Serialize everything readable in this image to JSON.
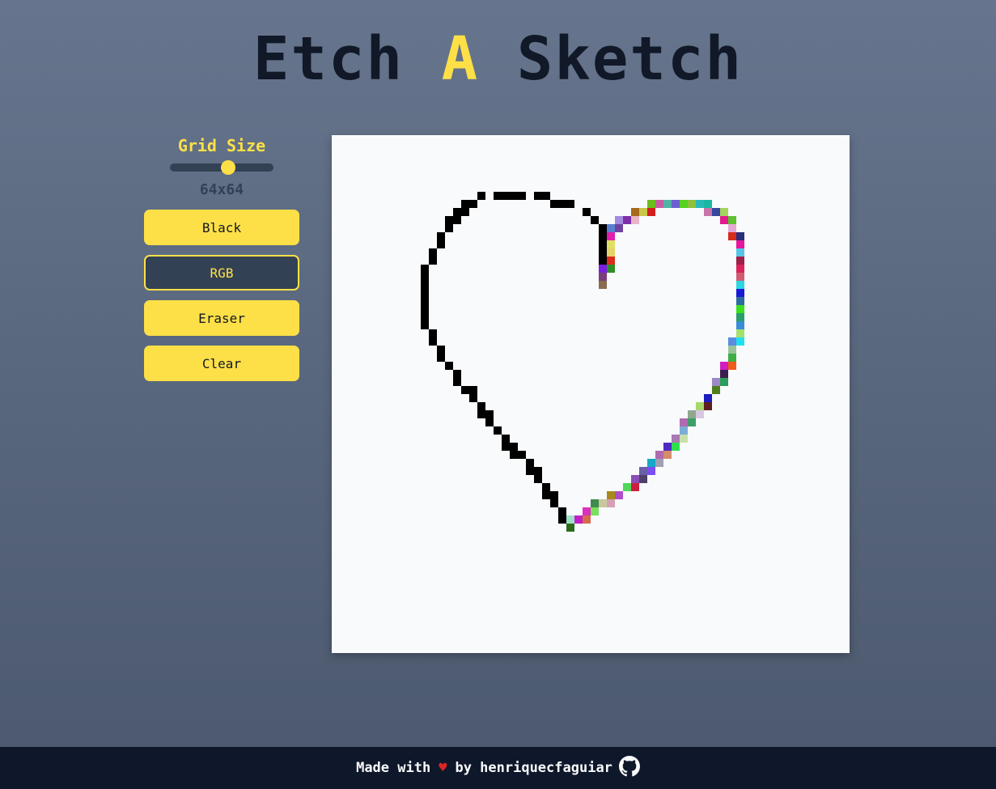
{
  "title": {
    "part1": "Etch ",
    "accent": "A",
    "part2": " Sketch"
  },
  "controls": {
    "grid_label": "Grid Size",
    "grid_value": "64x64",
    "slider_fraction": 0.56,
    "buttons": [
      {
        "label": "Black",
        "active": false
      },
      {
        "label": "RGB",
        "active": true
      },
      {
        "label": "Eraser",
        "active": false
      },
      {
        "label": "Clear",
        "active": false
      }
    ]
  },
  "grid": {
    "size": 64,
    "black_cells": [
      [
        18,
        7
      ],
      [
        20,
        7
      ],
      [
        21,
        7
      ],
      [
        22,
        7
      ],
      [
        23,
        7
      ],
      [
        25,
        7
      ],
      [
        26,
        7
      ],
      [
        16,
        8
      ],
      [
        17,
        8
      ],
      [
        27,
        8
      ],
      [
        28,
        8
      ],
      [
        29,
        8
      ],
      [
        15,
        9
      ],
      [
        16,
        9
      ],
      [
        31,
        9
      ],
      [
        14,
        10
      ],
      [
        15,
        10
      ],
      [
        32,
        10
      ],
      [
        14,
        11
      ],
      [
        33,
        11
      ],
      [
        13,
        12
      ],
      [
        33,
        12
      ],
      [
        13,
        13
      ],
      [
        33,
        13
      ],
      [
        12,
        14
      ],
      [
        33,
        14
      ],
      [
        12,
        15
      ],
      [
        33,
        15
      ],
      [
        11,
        16
      ],
      [
        11,
        17
      ],
      [
        11,
        18
      ],
      [
        11,
        19
      ],
      [
        11,
        20
      ],
      [
        11,
        21
      ],
      [
        11,
        22
      ],
      [
        11,
        23
      ],
      [
        12,
        24
      ],
      [
        12,
        25
      ],
      [
        13,
        26
      ],
      [
        13,
        27
      ],
      [
        14,
        28
      ],
      [
        15,
        29
      ],
      [
        15,
        30
      ],
      [
        16,
        31
      ],
      [
        17,
        31
      ],
      [
        17,
        32
      ],
      [
        18,
        33
      ],
      [
        18,
        34
      ],
      [
        19,
        34
      ],
      [
        19,
        35
      ],
      [
        20,
        36
      ],
      [
        21,
        37
      ],
      [
        21,
        38
      ],
      [
        22,
        38
      ],
      [
        22,
        39
      ],
      [
        23,
        39
      ],
      [
        24,
        40
      ],
      [
        24,
        41
      ],
      [
        25,
        41
      ],
      [
        25,
        42
      ],
      [
        26,
        43
      ],
      [
        26,
        44
      ],
      [
        27,
        44
      ],
      [
        27,
        45
      ],
      [
        28,
        46
      ],
      [
        28,
        47
      ]
    ],
    "color_cells": [
      [
        39,
        8,
        "#6abf1e"
      ],
      [
        40,
        8,
        "#c85ca2"
      ],
      [
        41,
        8,
        "#4fb3a3"
      ],
      [
        42,
        8,
        "#6b5fd1"
      ],
      [
        43,
        8,
        "#55d11f"
      ],
      [
        44,
        8,
        "#8ec03b"
      ],
      [
        45,
        8,
        "#2ab9b9"
      ],
      [
        46,
        8,
        "#1bb7a2"
      ],
      [
        37,
        9,
        "#a56a1c"
      ],
      [
        38,
        9,
        "#c8c84b"
      ],
      [
        39,
        9,
        "#d11e1e"
      ],
      [
        46,
        9,
        "#c774a8"
      ],
      [
        47,
        9,
        "#35489e"
      ],
      [
        48,
        9,
        "#a4d35f"
      ],
      [
        35,
        10,
        "#a48be0"
      ],
      [
        36,
        10,
        "#7e2fa8"
      ],
      [
        37,
        10,
        "#e8b4c8"
      ],
      [
        48,
        10,
        "#e01a8c"
      ],
      [
        49,
        10,
        "#5cc22f"
      ],
      [
        34,
        11,
        "#5a7fd1"
      ],
      [
        35,
        11,
        "#6e43a1"
      ],
      [
        49,
        11,
        "#e4a8d6"
      ],
      [
        34,
        12,
        "#e11fae"
      ],
      [
        49,
        12,
        "#d72b1c"
      ],
      [
        50,
        12,
        "#2b2d7a"
      ],
      [
        34,
        13,
        "#e0e063"
      ],
      [
        50,
        13,
        "#e6179a"
      ],
      [
        34,
        14,
        "#e6d26a"
      ],
      [
        50,
        14,
        "#56c5e8"
      ],
      [
        34,
        15,
        "#dc2b1c"
      ],
      [
        50,
        15,
        "#a01f4a"
      ],
      [
        33,
        16,
        "#7c1ee0"
      ],
      [
        34,
        16,
        "#2f8f27"
      ],
      [
        50,
        16,
        "#d9245c"
      ],
      [
        33,
        17,
        "#7a3f7b"
      ],
      [
        50,
        17,
        "#d15c72"
      ],
      [
        33,
        18,
        "#8b6b4e"
      ],
      [
        50,
        18,
        "#2ed6e0"
      ],
      [
        50,
        19,
        "#1a1ad6"
      ],
      [
        50,
        20,
        "#2d6b9e"
      ],
      [
        50,
        21,
        "#3be01d"
      ],
      [
        50,
        22,
        "#2b9e6b"
      ],
      [
        50,
        23,
        "#3a8cd6"
      ],
      [
        50,
        24,
        "#a4e06b"
      ],
      [
        50,
        25,
        "#22e0f0"
      ],
      [
        49,
        25,
        "#5a8ce0"
      ],
      [
        49,
        26,
        "#9bc49b"
      ],
      [
        49,
        27,
        "#3fae44"
      ],
      [
        48,
        28,
        "#d11ebf"
      ],
      [
        49,
        28,
        "#f05a1a"
      ],
      [
        48,
        29,
        "#3a1f4e"
      ],
      [
        47,
        30,
        "#9e87c7"
      ],
      [
        48,
        30,
        "#2a9e5a"
      ],
      [
        47,
        31,
        "#4e7f1c"
      ],
      [
        46,
        32,
        "#1c1cbf"
      ],
      [
        46,
        33,
        "#5e1f1f"
      ],
      [
        45,
        33,
        "#a8d86b"
      ],
      [
        44,
        34,
        "#90a790"
      ],
      [
        45,
        34,
        "#d8c8e0"
      ],
      [
        43,
        35,
        "#b06bb0"
      ],
      [
        44,
        35,
        "#3f9e6b"
      ],
      [
        43,
        36,
        "#7aaed6"
      ],
      [
        42,
        37,
        "#a97bb5"
      ],
      [
        43,
        37,
        "#c8e0a8"
      ],
      [
        41,
        38,
        "#4e2bbf"
      ],
      [
        42,
        38,
        "#2ee04e"
      ],
      [
        40,
        39,
        "#b06bb0"
      ],
      [
        41,
        39,
        "#d68b6b"
      ],
      [
        39,
        40,
        "#15a8c8"
      ],
      [
        40,
        40,
        "#9e9eb5"
      ],
      [
        38,
        41,
        "#6b5fa8"
      ],
      [
        39,
        41,
        "#7a4ef0"
      ],
      [
        37,
        42,
        "#8b4eb5"
      ],
      [
        38,
        42,
        "#4e3f6b"
      ],
      [
        36,
        43,
        "#50d65a"
      ],
      [
        37,
        43,
        "#cc1f3f"
      ],
      [
        34,
        44,
        "#a88a1c"
      ],
      [
        35,
        44,
        "#b04ec8"
      ],
      [
        32,
        45,
        "#3f8a4e"
      ],
      [
        33,
        45,
        "#c8c89e"
      ],
      [
        34,
        45,
        "#d6a0b5"
      ],
      [
        31,
        46,
        "#df2fbf"
      ],
      [
        32,
        46,
        "#78e05a"
      ],
      [
        29,
        47,
        "#9ee0c8"
      ],
      [
        30,
        47,
        "#c21fc8"
      ],
      [
        31,
        47,
        "#d66b4e"
      ],
      [
        29,
        48,
        "#2b6b1c"
      ]
    ]
  },
  "footer": {
    "made_with": "Made with",
    "heart": "♥",
    "by": "by henriquecfaguiar"
  },
  "icons": {
    "heart": "heart-icon",
    "github": "github-icon"
  },
  "colors": {
    "accent": "#fde047",
    "dark": "#111827",
    "footer_bg": "#0f172a",
    "canvas_bg": "#f8fafc"
  }
}
